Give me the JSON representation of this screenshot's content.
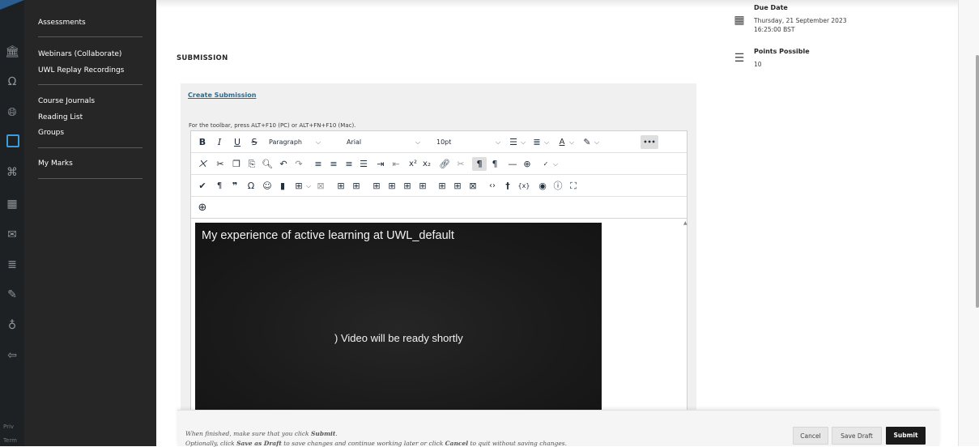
{
  "course_menu": {
    "items": [
      {
        "label": "Assessments"
      },
      {
        "label": "Webinars (Collaborate)"
      },
      {
        "label": "UWL Replay Recordings"
      },
      {
        "label": "Course Journals"
      },
      {
        "label": "Reading List"
      },
      {
        "label": "Groups"
      },
      {
        "label": "My Marks"
      }
    ]
  },
  "rail": {
    "icons": [
      "institution-icon",
      "profile-icon",
      "globe-icon",
      "courses-icon",
      "organizations-icon",
      "calendar-icon",
      "messages-icon",
      "grades-icon",
      "assist-icon",
      "tools-icon",
      "sign-out-icon"
    ],
    "footer": [
      "Priv",
      "Term"
    ]
  },
  "assignment": {
    "section_title": "SUBMISSION",
    "create_link": "Create Submission",
    "toolbar_hint": "For the toolbar, press ALT+F10 (PC) or ALT+FN+F10 (Mac)."
  },
  "editor": {
    "paragraph_select": "Paragraph",
    "font_select": "Arial",
    "size_select": "10pt",
    "buttons": {
      "bold": "B",
      "italic": "I",
      "underline": "U",
      "strike": "S",
      "more": "•••"
    }
  },
  "video": {
    "title": "My experience of active learning at UWL_default",
    "status": ")  Video will be ready shortly"
  },
  "info": {
    "due_label": "Due Date",
    "due_date": "Thursday, 21 September 2023",
    "due_time": "16:25:00 BST",
    "points_label": "Points Possible",
    "points_value": "10"
  },
  "footer": {
    "line1_prefix": "When finished, make sure that you click ",
    "line1_bold": "Submit",
    "line1_suffix": ".",
    "line2_a": "Optionally, click ",
    "line2_b": "Save as Draft",
    "line2_c": " to save changes and continue working later or click ",
    "line2_d": "Cancel",
    "line2_e": " to quit without saving changes.",
    "cancel": "Cancel",
    "save_draft": "Save Draft",
    "submit": "Submit"
  }
}
